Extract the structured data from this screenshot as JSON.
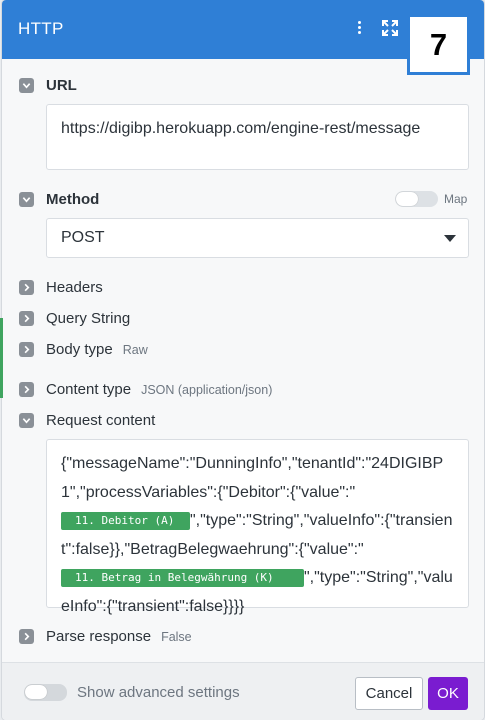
{
  "header": {
    "title": "HTTP",
    "step_number": "7"
  },
  "url": {
    "label": "URL",
    "value": "https://digibp.herokuapp.com/engine-rest/message"
  },
  "method": {
    "label": "Method",
    "value": "POST",
    "map_label": "Map"
  },
  "headers": {
    "label": "Headers"
  },
  "query_string": {
    "label": "Query String"
  },
  "body_type": {
    "label": "Body type",
    "value": "Raw"
  },
  "content_type": {
    "label": "Content type",
    "value": "JSON (application/json)"
  },
  "request_content": {
    "label": "Request content",
    "text_1": "{\"messageName\":\"DunningInfo\",\"tenantId\":\"24DIGIBP1\",\"processVariables\":{\"Debitor\":{\"value\":\"",
    "pill_1": "11. Debitor (A)",
    "text_2": "\",\"type\":\"String\",\"valueInfo\":{\"transient\":false}},\"BetragBelegwaehrung\":{\"value\":\"",
    "pill_2": "11. Betrag in Belegwährung (K)",
    "text_3": "\",\"type\":\"String\",\"valueInfo\":{\"transient\":false}}}}"
  },
  "parse_response": {
    "label": "Parse response",
    "value": "False"
  },
  "footer": {
    "advanced_label": "Show advanced settings",
    "cancel_label": "Cancel",
    "ok_label": "OK"
  },
  "colors": {
    "header_blue": "#2f7fd6",
    "pill_green": "#3fa45f",
    "ok_purple": "#7a1cd0"
  }
}
